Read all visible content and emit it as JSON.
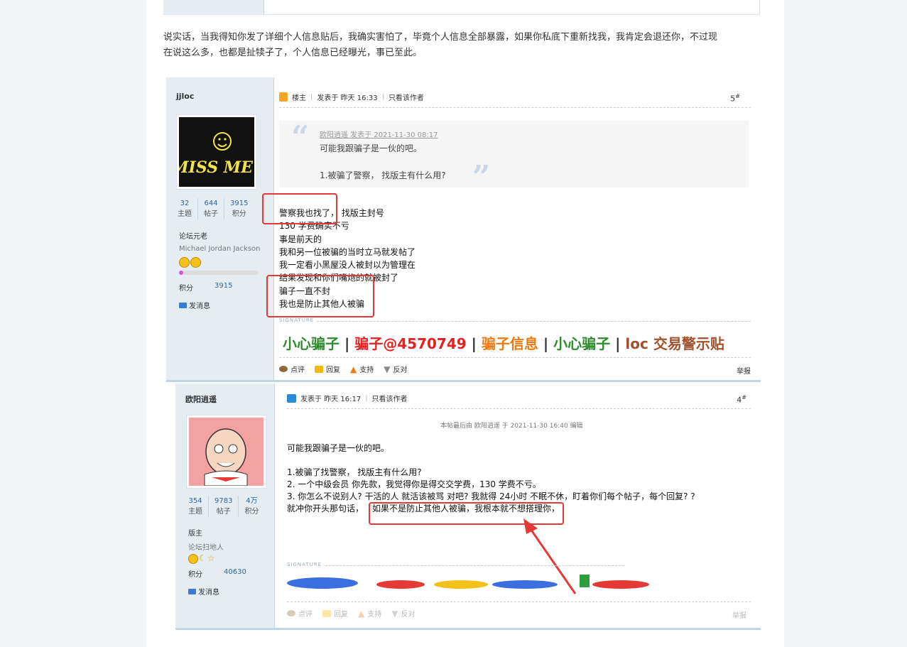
{
  "article": {
    "paragraph_line1": "说实话，当我得知你发了详细个人信息贴后，我确实害怕了，毕竟个人信息全部暴露，如果你私底下重新找我，我肯定会退还你，不过现",
    "paragraph_line2": "在说这么多，也都是扯犊子了，个人信息已经曝光，事已至此。"
  },
  "post1": {
    "username": "jjloc",
    "avatar_text": "MISS ME?",
    "stats": [
      {
        "value": "32",
        "label": "主题"
      },
      {
        "value": "644",
        "label": "帖子"
      },
      {
        "value": "3915",
        "label": "积分"
      }
    ],
    "rank": "论坛元老",
    "custom_title": "Michael Jordan Jackson",
    "points_label": "积分",
    "points_value": "3915",
    "send_message": "发消息",
    "header_owner": "楼主",
    "header_posted": "发表于 昨天 16:33",
    "header_only_author": "只看该作者",
    "floor": "5",
    "floor_mark": "#",
    "quote_head": "欧阳逍遥 发表于 2021-11-30 08:17",
    "quote_line1": "可能我跟骗子是一伙的吧。",
    "quote_line2": "1.被骗了警察， 找版主有什么用?",
    "body": [
      "警察我也找了，  找版主封号",
      "130 学费确实不亏",
      "事是前天的",
      "我和另一位被骗的当时立马就发帖了",
      "我一定看小黑屋没人被封以为管理在",
      "结果发现和你们嘴炮的就被封了",
      "骗子一直不封",
      "我也是防止其他人被骗"
    ],
    "signature_label": "SIGNATURE",
    "signature": {
      "a": "小心骗子",
      "sep": "|",
      "b": "骗子@4570749",
      "c": "骗子信息",
      "d": "小心骗子",
      "e": "loc 交易警示贴"
    },
    "actions": {
      "comment": "点评",
      "reply": "回复",
      "support": "支持",
      "oppose": "反对"
    },
    "report": "举报"
  },
  "post2": {
    "username": "欧阳逍遥",
    "stats": [
      {
        "value": "354",
        "label": "主题"
      },
      {
        "value": "9783",
        "label": "帖子"
      },
      {
        "value": "4万",
        "label": "积分"
      }
    ],
    "rank": "版主",
    "custom_title": "论坛扫地人",
    "points_label": "积分",
    "points_value": "40630",
    "send_message": "发消息",
    "header_posted": "发表于 昨天 16:17",
    "header_only_author": "只看该作者",
    "floor": "4",
    "floor_mark": "#",
    "edit_note": "本帖最后由 欧阳逍遥 于 2021-11-30 16:40 编辑",
    "body": [
      "可能我跟骗子是一伙的吧。",
      "1.被骗了找警察， 找版主有什么用?",
      "2. 一个中级会员 你先款，我觉得你是得交交学费，130 学费不亏。",
      "3. 你怎么不说别人?  干活的人 就活该被骂 对吧?  我就得 24小时 不眠不休，盯着你们每个帖子，每个回复? ?",
      "就冲你开头那句话，",
      "如果不是防止其他人被骗，我根本就不想搭理你，"
    ],
    "signature_label": "SIGNATURE",
    "actions": {
      "comment": "点评",
      "reply": "回复",
      "support": "支持",
      "oppose": "反对"
    },
    "report": "举报"
  },
  "colors": {
    "red_box": "#e53935",
    "sig_green": "#2e8b2e",
    "sig_red": "#e52222",
    "sig_orange": "#f07a12",
    "sig_brown": "#a0522d",
    "sidebar_bg": "#e5edf2"
  }
}
